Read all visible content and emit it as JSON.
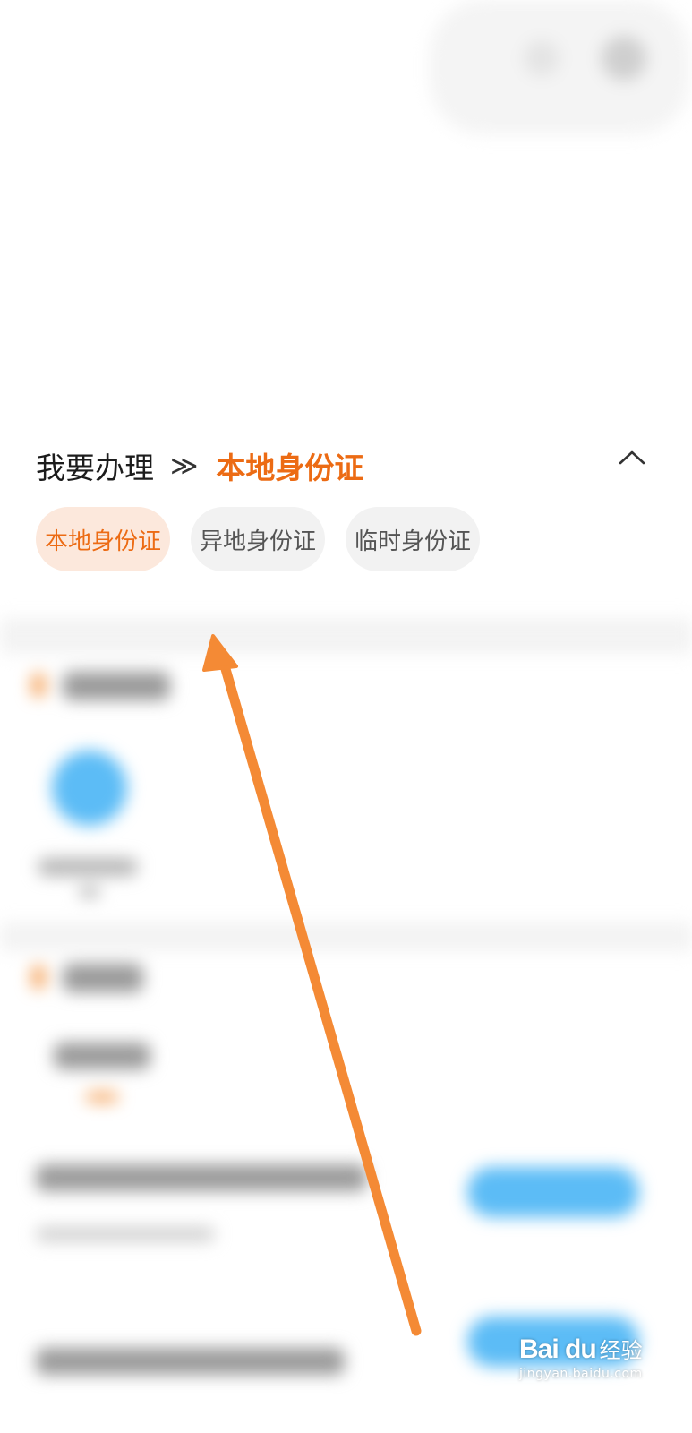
{
  "breadcrumb": {
    "label": "我要办理",
    "separator": "≫",
    "current": "本地身份证"
  },
  "collapse_icon": "chevron-up-icon",
  "chips": [
    {
      "label": "本地身份证",
      "selected": true
    },
    {
      "label": "异地身份证",
      "selected": false
    },
    {
      "label": "临时身份证",
      "selected": false
    }
  ],
  "watermark": {
    "logo": "Bai du",
    "suffix": "经验",
    "url": "jingyan.baidu.com"
  },
  "colors": {
    "accent": "#ec6b14",
    "chip_selected_bg": "#fce8dc",
    "chip_bg": "#f2f2f2",
    "annotation_arrow": "#f48a35",
    "blurred_blue": "#5cbcf6"
  }
}
